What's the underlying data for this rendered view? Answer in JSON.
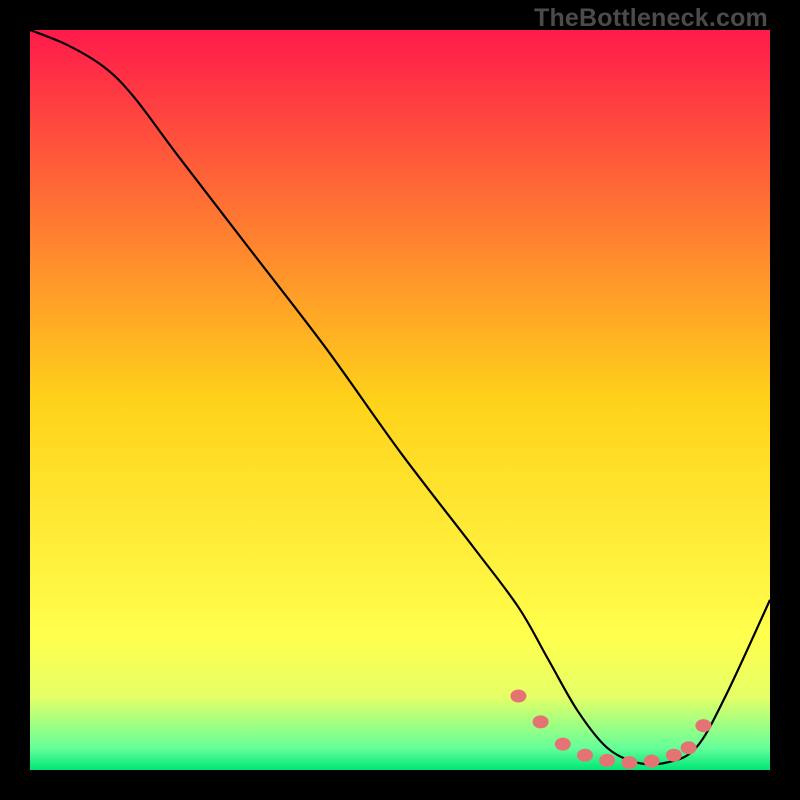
{
  "watermark": "TheBottleneck.com",
  "chart_data": {
    "type": "line",
    "title": "",
    "xlabel": "",
    "ylabel": "",
    "xlim": [
      0,
      100
    ],
    "ylim": [
      0,
      100
    ],
    "grid": false,
    "legend": false,
    "background_gradient": {
      "stops": [
        {
          "pos": 0.0,
          "color": "#ff1a4b"
        },
        {
          "pos": 0.5,
          "color": "#ffd21a"
        },
        {
          "pos": 0.82,
          "color": "#ffff4d"
        },
        {
          "pos": 0.9,
          "color": "#e6ff66"
        },
        {
          "pos": 0.97,
          "color": "#66ff99"
        },
        {
          "pos": 1.0,
          "color": "#00e676"
        }
      ]
    },
    "series": [
      {
        "name": "bottleneck-curve",
        "color": "#000000",
        "x": [
          0,
          5,
          10,
          14,
          20,
          30,
          40,
          50,
          60,
          66,
          70,
          74,
          78,
          82,
          86,
          90,
          94,
          100
        ],
        "values": [
          100,
          98,
          95,
          91,
          83,
          70,
          57,
          43,
          30,
          22,
          15,
          8,
          3,
          1,
          1,
          3,
          10,
          23
        ]
      }
    ],
    "markers": {
      "name": "highlight-dots",
      "color": "#e57373",
      "points": [
        {
          "x": 66,
          "y": 10
        },
        {
          "x": 69,
          "y": 6.5
        },
        {
          "x": 72,
          "y": 3.5
        },
        {
          "x": 75,
          "y": 2
        },
        {
          "x": 78,
          "y": 1.3
        },
        {
          "x": 81,
          "y": 1
        },
        {
          "x": 84,
          "y": 1.2
        },
        {
          "x": 87,
          "y": 2
        },
        {
          "x": 89,
          "y": 3
        },
        {
          "x": 91,
          "y": 6
        }
      ]
    }
  }
}
